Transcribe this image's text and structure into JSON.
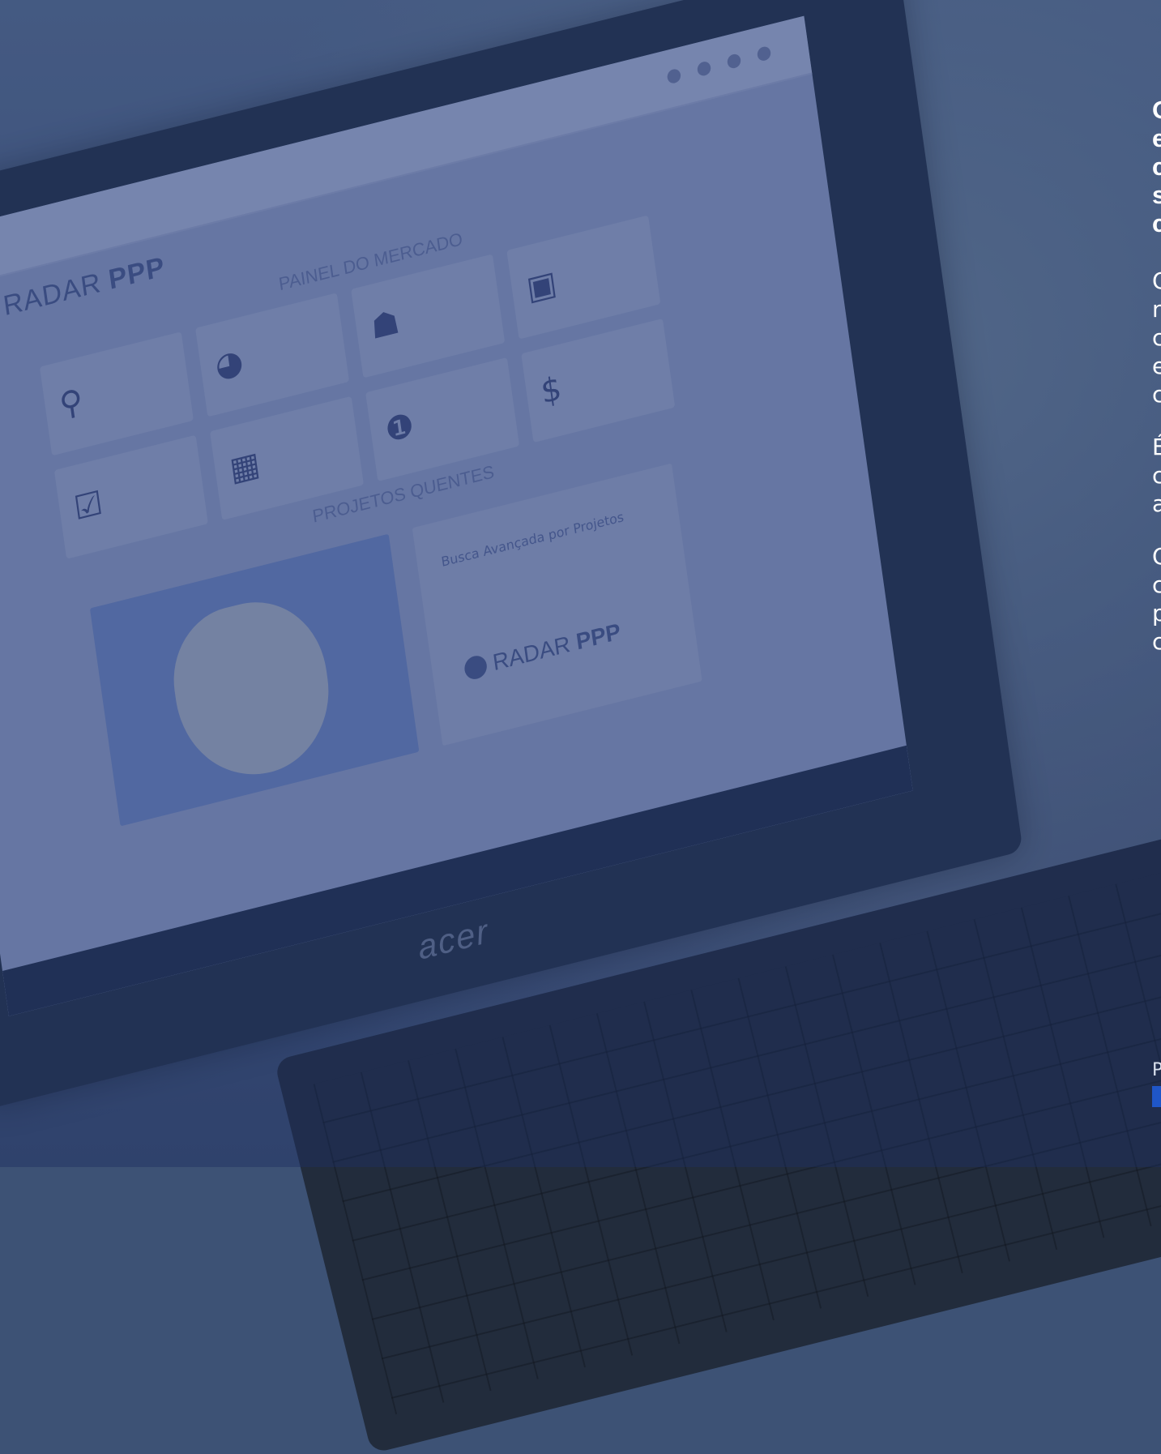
{
  "screen": {
    "logo_prefix": "RADAR",
    "logo_suffix": "PPP",
    "section_title": "PAINEL DO MERCADO",
    "tile_icons": [
      "map-pin-icon",
      "pie-chart-icon",
      "people-icon",
      "money-icon",
      "check-icon",
      "calendar-icon",
      "info-icon",
      "dollar-icon"
    ],
    "tile_glyphs": [
      "⚲",
      "◕",
      "☗",
      "▣",
      "☑",
      "▦",
      "❶",
      "$"
    ],
    "projects_title": "PROJETOS QUENTES",
    "search_title": "Busca Avançada por Projetos",
    "laptop_brand": "acer"
  },
  "sidebar": {
    "headline": [
      "O",
      "e",
      "c",
      "s",
      "c"
    ],
    "paragraphs": [
      [
        "O",
        "n",
        "c",
        "e",
        "c"
      ],
      [
        "É",
        "c",
        "a"
      ],
      [
        "O",
        "c",
        "p",
        "c"
      ]
    ],
    "footer_label": "P"
  },
  "colors": {
    "overlay": "#1e326e",
    "link": "#1f56c8"
  }
}
